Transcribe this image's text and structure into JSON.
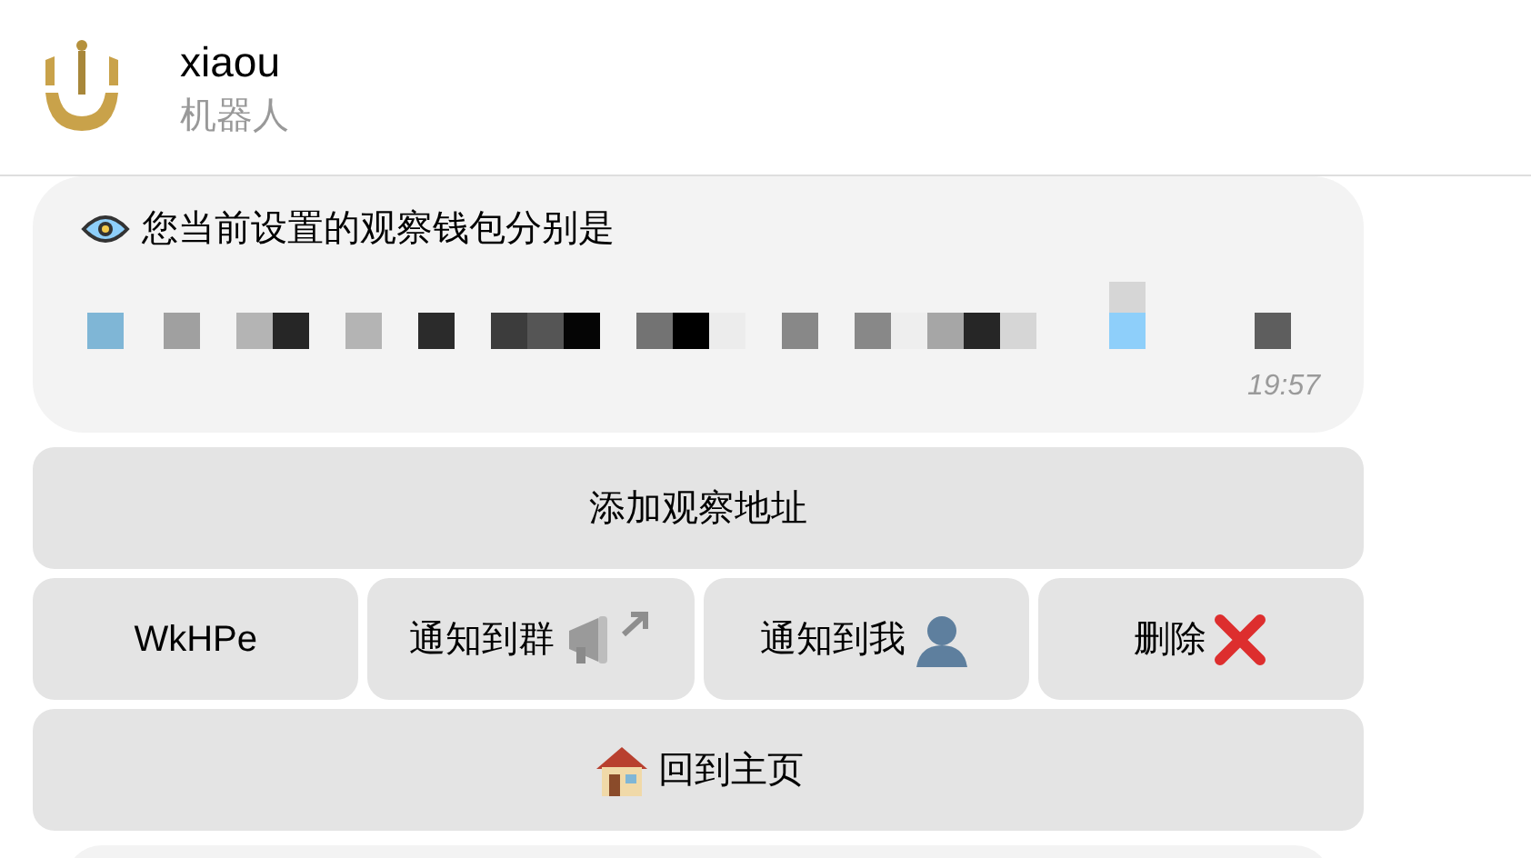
{
  "header": {
    "title": "xiaou",
    "subtitle": "机器人"
  },
  "message": {
    "text": "您当前设置的观察钱包分别是",
    "time": "19:57"
  },
  "keyboard": [
    [
      {
        "label": "添加观察地址",
        "kind": "plain"
      }
    ],
    [
      {
        "label": "WkHPe",
        "kind": "plain"
      },
      {
        "label": "通知到群",
        "kind": "broadcast"
      },
      {
        "label": "通知到我",
        "kind": "personal"
      },
      {
        "label": "删除",
        "kind": "delete"
      }
    ],
    [
      {
        "label": "回到主页",
        "kind": "home"
      }
    ]
  ]
}
